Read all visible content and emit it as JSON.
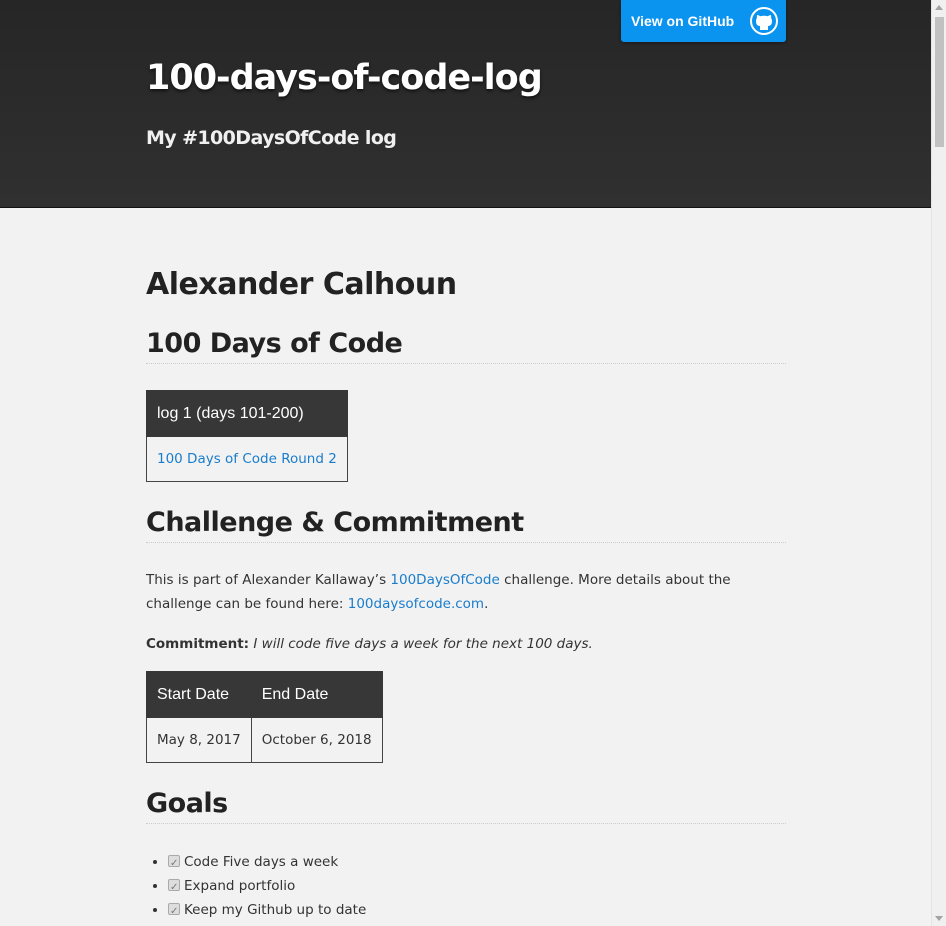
{
  "header": {
    "title": "100-days-of-code-log",
    "subtitle": "My #100DaysOfCode log",
    "github_button": "View on GitHub",
    "github_icon": "github-octocat-icon"
  },
  "main": {
    "name": "Alexander Calhoun",
    "section_100": {
      "heading": "100 Days of Code",
      "table_header": "log 1 (days 101-200)",
      "table_link": "100 Days of Code Round 2"
    },
    "section_challenge": {
      "heading": "Challenge & Commitment",
      "text_1": "This is part of Alexander Kallaway’s ",
      "link_1": "100DaysOfCode",
      "text_2": " challenge. More details about the challenge can be found here: ",
      "link_2": "100daysofcode.com",
      "text_3": ".",
      "commitment_label": "Commitment:",
      "commitment_text": "I will code five days a week for the next 100 days.",
      "dates_headers": [
        "Start Date",
        "End Date"
      ],
      "dates_values": [
        "May 8, 2017",
        "October 6, 2018"
      ]
    },
    "section_goals": {
      "heading": "Goals",
      "items": [
        "Code Five days a week",
        "Expand portfolio",
        "Keep my Github up to date"
      ]
    }
  },
  "colors": {
    "header_bg": "#2b2b2b",
    "button_bg": "#0b93f0",
    "link": "#1a7dcc",
    "table_header_bg": "#373737"
  }
}
